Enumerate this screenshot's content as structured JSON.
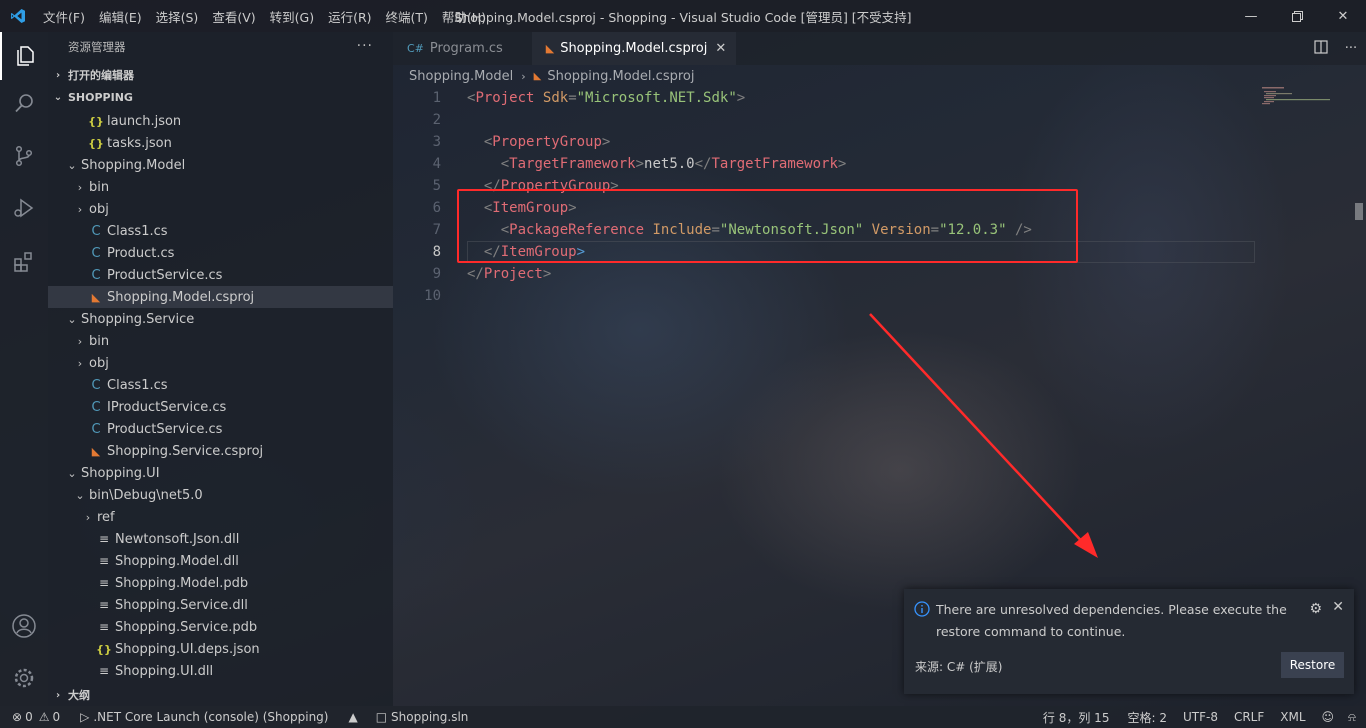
{
  "window": {
    "title": "Shopping.Model.csproj - Shopping - Visual Studio Code [管理员] [不受支持]",
    "menu": [
      "文件(F)",
      "编辑(E)",
      "选择(S)",
      "查看(V)",
      "转到(G)",
      "运行(R)",
      "终端(T)",
      "帮助(H)"
    ]
  },
  "sidebar": {
    "header": "资源管理器",
    "open_editors": "打开的编辑器",
    "workspace": "SHOPPING",
    "outline": "大纲",
    "tree": [
      {
        "label": "launch.json",
        "icon": "json",
        "indent": 1,
        "twist": ""
      },
      {
        "label": "tasks.json",
        "icon": "json",
        "indent": 1,
        "twist": ""
      },
      {
        "label": "Shopping.Model",
        "icon": "",
        "indent": 0,
        "twist": "open"
      },
      {
        "label": "bin",
        "icon": "",
        "indent": 1,
        "twist": "closed"
      },
      {
        "label": "obj",
        "icon": "",
        "indent": 1,
        "twist": "closed"
      },
      {
        "label": "Class1.cs",
        "icon": "cs",
        "indent": 1,
        "twist": ""
      },
      {
        "label": "Product.cs",
        "icon": "cs",
        "indent": 1,
        "twist": ""
      },
      {
        "label": "ProductService.cs",
        "icon": "cs",
        "indent": 1,
        "twist": ""
      },
      {
        "label": "Shopping.Model.csproj",
        "icon": "rss",
        "indent": 1,
        "twist": "",
        "selected": true
      },
      {
        "label": "Shopping.Service",
        "icon": "",
        "indent": 0,
        "twist": "open"
      },
      {
        "label": "bin",
        "icon": "",
        "indent": 1,
        "twist": "closed"
      },
      {
        "label": "obj",
        "icon": "",
        "indent": 1,
        "twist": "closed"
      },
      {
        "label": "Class1.cs",
        "icon": "cs",
        "indent": 1,
        "twist": ""
      },
      {
        "label": "IProductService.cs",
        "icon": "cs",
        "indent": 1,
        "twist": ""
      },
      {
        "label": "ProductService.cs",
        "icon": "cs",
        "indent": 1,
        "twist": ""
      },
      {
        "label": "Shopping.Service.csproj",
        "icon": "rss",
        "indent": 1,
        "twist": ""
      },
      {
        "label": "Shopping.UI",
        "icon": "",
        "indent": 0,
        "twist": "open"
      },
      {
        "label": "bin\\Debug\\net5.0",
        "icon": "",
        "indent": 1,
        "twist": "open"
      },
      {
        "label": "ref",
        "icon": "",
        "indent": 2,
        "twist": "closed"
      },
      {
        "label": "Newtonsoft.Json.dll",
        "icon": "file",
        "indent": 2,
        "twist": ""
      },
      {
        "label": "Shopping.Model.dll",
        "icon": "file",
        "indent": 2,
        "twist": ""
      },
      {
        "label": "Shopping.Model.pdb",
        "icon": "file",
        "indent": 2,
        "twist": ""
      },
      {
        "label": "Shopping.Service.dll",
        "icon": "file",
        "indent": 2,
        "twist": ""
      },
      {
        "label": "Shopping.Service.pdb",
        "icon": "file",
        "indent": 2,
        "twist": ""
      },
      {
        "label": "Shopping.UI.deps.json",
        "icon": "json",
        "indent": 2,
        "twist": ""
      },
      {
        "label": "Shopping.UI.dll",
        "icon": "file",
        "indent": 2,
        "twist": ""
      }
    ]
  },
  "tabs": [
    {
      "label": "Program.cs",
      "icon": "cs",
      "active": false
    },
    {
      "label": "Shopping.Model.csproj",
      "icon": "rss",
      "active": true
    }
  ],
  "breadcrumb": [
    "Shopping.Model",
    "Shopping.Model.csproj"
  ],
  "code": {
    "current_line": 8,
    "lines": [
      [
        [
          "punc",
          "<"
        ],
        [
          "tag",
          "Project"
        ],
        [
          "txt",
          " "
        ],
        [
          "attr",
          "Sdk"
        ],
        [
          "punc",
          "="
        ],
        [
          "str",
          "\"Microsoft.NET.Sdk\""
        ],
        [
          "punc",
          ">"
        ]
      ],
      [],
      [
        [
          "txt",
          "  "
        ],
        [
          "punc",
          "<"
        ],
        [
          "tag",
          "PropertyGroup"
        ],
        [
          "punc",
          ">"
        ]
      ],
      [
        [
          "txt",
          "    "
        ],
        [
          "punc",
          "<"
        ],
        [
          "tag",
          "TargetFramework"
        ],
        [
          "punc",
          ">"
        ],
        [
          "txt",
          "net5.0"
        ],
        [
          "punc",
          "</"
        ],
        [
          "tag",
          "TargetFramework"
        ],
        [
          "punc",
          ">"
        ]
      ],
      [
        [
          "txt",
          "  "
        ],
        [
          "punc",
          "</"
        ],
        [
          "tag",
          "PropertyGroup"
        ],
        [
          "punc",
          ">"
        ]
      ],
      [
        [
          "txt",
          "  "
        ],
        [
          "punc",
          "<"
        ],
        [
          "tag",
          "ItemGroup"
        ],
        [
          "punc",
          ">"
        ]
      ],
      [
        [
          "txt",
          "    "
        ],
        [
          "punc",
          "<"
        ],
        [
          "tag",
          "PackageReference"
        ],
        [
          "txt",
          " "
        ],
        [
          "attr",
          "Include"
        ],
        [
          "punc",
          "="
        ],
        [
          "str",
          "\"Newtonsoft.Json\""
        ],
        [
          "txt",
          " "
        ],
        [
          "attr",
          "Version"
        ],
        [
          "punc",
          "="
        ],
        [
          "str",
          "\"12.0.3\""
        ],
        [
          "txt",
          " "
        ],
        [
          "punc",
          "/>"
        ]
      ],
      [
        [
          "txt",
          "  "
        ],
        [
          "punc",
          "</"
        ],
        [
          "tag",
          "ItemGroup"
        ],
        [
          "bl",
          ">"
        ]
      ],
      [
        [
          "punc",
          "</"
        ],
        [
          "tag",
          "Project"
        ],
        [
          "punc",
          ">"
        ]
      ],
      []
    ]
  },
  "notification": {
    "message": "There are unresolved dependencies. Please execute the restore command to continue.",
    "source": "来源: C# (扩展)",
    "button": "Restore"
  },
  "statusbar": {
    "errors": "0",
    "warnings": "0",
    "launch": ".NET Core Launch (console) (Shopping)",
    "solution": "Shopping.sln",
    "position": "行 8，列 15",
    "spaces": "空格: 2",
    "encoding": "UTF-8",
    "eol": "CRLF",
    "language": "XML"
  },
  "colors": {
    "accent_red": "#ff2a2a",
    "xml_tag": "#e06c75",
    "xml_attr": "#d19a66",
    "xml_string": "#98c379"
  }
}
